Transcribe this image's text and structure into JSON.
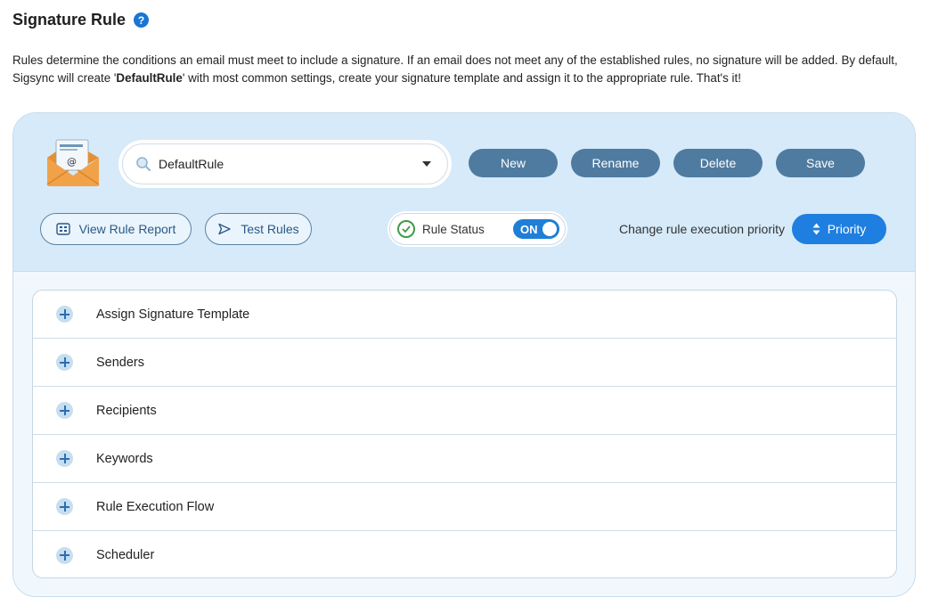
{
  "header": {
    "title": "Signature Rule",
    "help_glyph": "?"
  },
  "description": {
    "part1": "Rules determine the conditions an email must meet to include a signature. If an email does not meet any of the established rules, no signature will be added. By default, Sigsync will create '",
    "bold": "DefaultRule",
    "part2": "' with most common settings, create your signature template and assign it to the appropriate rule. That's it!"
  },
  "toolbar": {
    "rule_select_value": "DefaultRule",
    "new_label": "New",
    "rename_label": "Rename",
    "delete_label": "Delete",
    "save_label": "Save",
    "view_report_label": "View Rule Report",
    "test_rules_label": "Test Rules",
    "rule_status_label": "Rule Status",
    "toggle_text": "ON",
    "priority_text": "Change rule execution priority",
    "priority_label": "Priority"
  },
  "sections": [
    {
      "label": "Assign Signature Template"
    },
    {
      "label": "Senders"
    },
    {
      "label": "Recipients"
    },
    {
      "label": "Keywords"
    },
    {
      "label": "Rule Execution Flow"
    },
    {
      "label": "Scheduler"
    }
  ],
  "colors": {
    "accent_blue": "#1e7fe0",
    "action_button": "#4f7ba0",
    "panel_top": "#d6eaf9",
    "status_green": "#3f9a4a"
  },
  "icons": {
    "help": "help-icon",
    "mail": "mail-envelope-icon",
    "search": "search-icon",
    "caret": "caret-down-icon",
    "report": "report-grid-icon",
    "test": "play-triangle-icon",
    "status": "check-circle-icon",
    "priority": "sort-arrows-icon",
    "expand": "plus-icon"
  }
}
